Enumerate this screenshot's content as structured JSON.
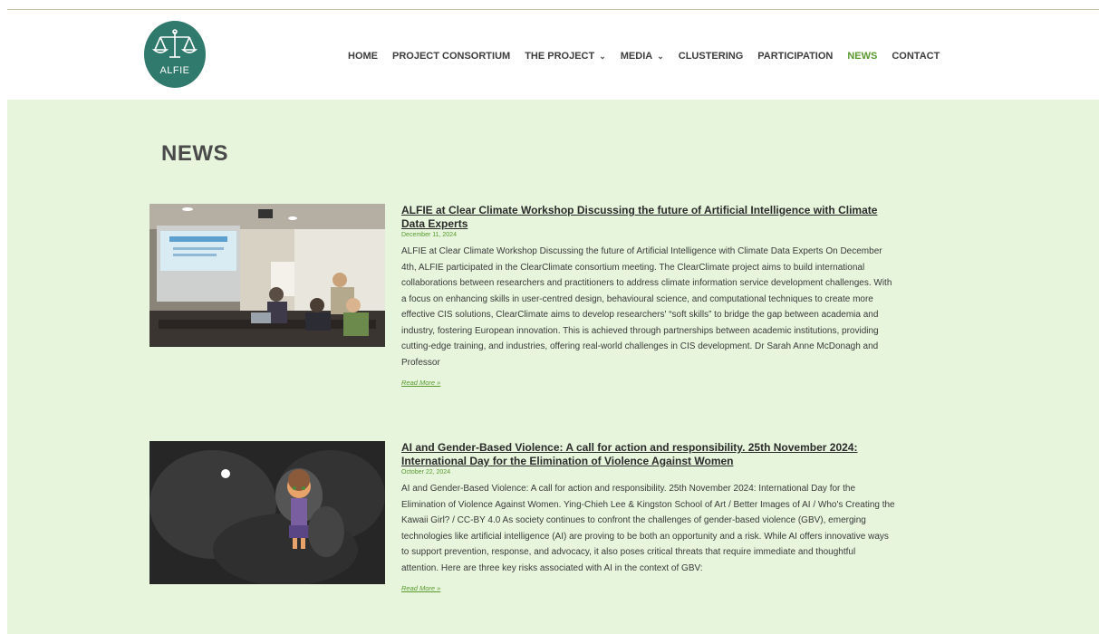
{
  "site": {
    "logo_text": "ALFIE"
  },
  "nav": [
    {
      "label": "HOME",
      "dropdown": false,
      "active": false
    },
    {
      "label": "PROJECT CONSORTIUM",
      "dropdown": false,
      "active": false
    },
    {
      "label": "THE PROJECT",
      "dropdown": true,
      "active": false
    },
    {
      "label": "MEDIA",
      "dropdown": true,
      "active": false
    },
    {
      "label": "CLUSTERING",
      "dropdown": false,
      "active": false
    },
    {
      "label": "PARTICIPATION",
      "dropdown": false,
      "active": false
    },
    {
      "label": "NEWS",
      "dropdown": false,
      "active": true
    },
    {
      "label": "CONTACT",
      "dropdown": false,
      "active": false
    }
  ],
  "page": {
    "title": "NEWS"
  },
  "posts": [
    {
      "title": "ALFIE at Clear Climate Workshop Discussing the future of Artificial Intelligence with Climate Data Experts",
      "date": "December 11, 2024",
      "excerpt": "ALFIE at Clear Climate Workshop Discussing the future of Artificial Intelligence with Climate Data Experts On December 4th, ALFIE participated in the ClearClimate consortium meeting. The ClearClimate project aims to build international collaborations between researchers and practitioners to address climate information service development challenges. With a focus on enhancing skills in user-centred design, behavioural science, and computational techniques to create more effective CIS solutions, ClearClimate aims to develop researchers' “soft skills” to bridge the gap between academia and industry, fostering European innovation. This is achieved through partnerships between academic institutions, providing cutting-edge training, and industries, offering real-world challenges in CIS development. Dr Sarah Anne McDonagh and Professor",
      "read_more": "Read More »"
    },
    {
      "title": "AI and Gender-Based Violence: A call for action and responsibility. 25th November 2024: International Day for the Elimination of Violence Against Women",
      "date": "October 22, 2024",
      "excerpt": "AI and Gender-Based Violence: A call for action and responsibility. 25th November 2024: International Day for the Elimination of Violence Against Women. Ying-Chieh Lee & Kingston School of Art / Better Images of AI / Who's Creating the Kawaii Girl? / CC-BY 4.0 As society continues to confront the challenges of gender-based violence (GBV), emerging technologies like artificial intelligence (AI) are proving to be both an opportunity and a risk. While AI offers innovative ways to support prevention, response, and advocacy, it also poses critical threats that require immediate and thoughtful attention. Here are three key risks associated with AI in the context of GBV:",
      "read_more": "Read More »"
    }
  ],
  "colors": {
    "accent_green": "#5a9a2f",
    "logo_teal": "#2f7a6c",
    "content_bg": "#e6f5dc"
  }
}
